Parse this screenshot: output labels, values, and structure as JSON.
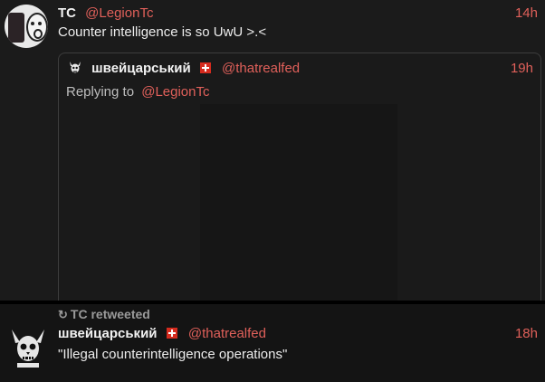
{
  "colors": {
    "accent": "#e0605a",
    "background": "#171717",
    "text": "#ededed",
    "muted": "#9a9a9a"
  },
  "tweet": {
    "name": "TC",
    "handle": "@LegionTc",
    "time": "14h",
    "text": "Counter intelligence is so UwU >.<",
    "avatar_icon": "wojak-avatar-icon"
  },
  "quoted": {
    "name": "швейцарський",
    "flag_icon": "swiss-flag-icon",
    "handle": "@thatrealfed",
    "time": "19h",
    "replying_prefix": "Replying to",
    "replying_handle": "@LegionTc",
    "avatar_icon": "horned-skull-icon"
  },
  "retweet": {
    "label": "TC retweeted",
    "icon": "retweet-icon",
    "name": "швейцарський",
    "flag_icon": "swiss-flag-icon",
    "handle": "@thatrealfed",
    "time": "18h",
    "text": "\"Illegal counterintelligence operations\"",
    "avatar_icon": "horned-skull-icon"
  }
}
